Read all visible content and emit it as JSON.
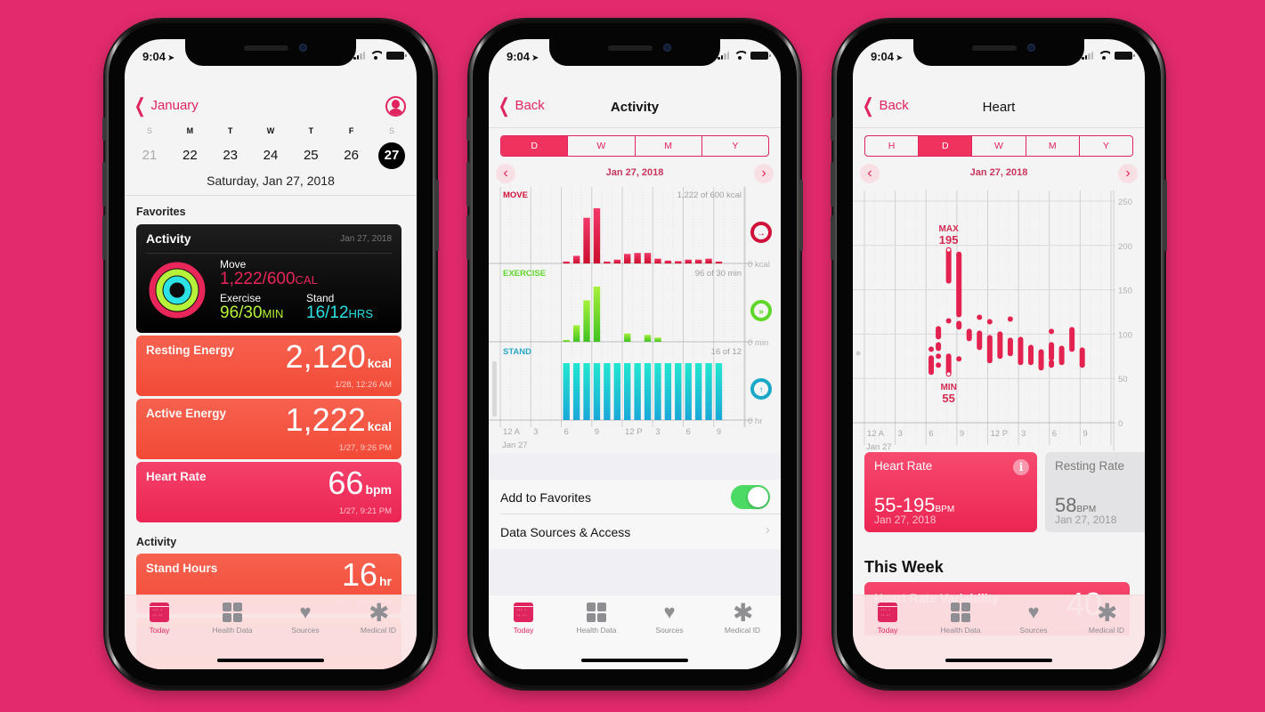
{
  "status_bar": {
    "time": "9:04"
  },
  "tab_bar": [
    {
      "label": "Today",
      "icon": "calendar-icon",
      "active": true
    },
    {
      "label": "Health Data",
      "icon": "grid-icon",
      "active": false
    },
    {
      "label": "Sources",
      "icon": "heart-download-icon",
      "active": false
    },
    {
      "label": "Medical ID",
      "icon": "asterisk-icon",
      "active": false
    }
  ],
  "today": {
    "back_label": "January",
    "week": [
      {
        "letter": "S",
        "num": "21"
      },
      {
        "letter": "M",
        "num": "22"
      },
      {
        "letter": "T",
        "num": "23"
      },
      {
        "letter": "W",
        "num": "24"
      },
      {
        "letter": "T",
        "num": "25"
      },
      {
        "letter": "F",
        "num": "26"
      },
      {
        "letter": "S",
        "num": "27"
      }
    ],
    "full_date": "Saturday, Jan 27, 2018",
    "favorites_label": "Favorites",
    "activity_card": {
      "title": "Activity",
      "date": "Jan 27, 2018",
      "move_label": "Move",
      "move_value": "1,222/600",
      "move_unit": "CAL",
      "exercise_label": "Exercise",
      "exercise_value": "96/30",
      "exercise_unit": "MIN",
      "stand_label": "Stand",
      "stand_value": "16/12",
      "stand_unit": "HRS",
      "rings": {
        "move": 2.04,
        "exercise": 3.2,
        "stand": 1.33
      }
    },
    "cards": [
      {
        "name": "Resting Energy",
        "value": "2,120",
        "unit": "kcal",
        "when": "1/28, 12:26 AM"
      },
      {
        "name": "Active Energy",
        "value": "1,222",
        "unit": "kcal",
        "when": "1/27, 9:26 PM"
      },
      {
        "name": "Heart Rate",
        "value": "66",
        "unit": "bpm",
        "when": "1/27, 9:21 PM"
      }
    ],
    "activity_label": "Activity",
    "stand_card": {
      "name": "Stand Hours",
      "value": "16",
      "unit": "hr",
      "when": "1/27, 10:00 PM"
    }
  },
  "activity": {
    "back_label": "Back",
    "title": "Activity",
    "segments": [
      "D",
      "W",
      "M",
      "Y"
    ],
    "selected_segment": "D",
    "date": "Jan 27, 2018",
    "add_to_favorites": "Add to Favorites",
    "add_to_favorites_on": true,
    "data_sources": "Data Sources & Access"
  },
  "heart": {
    "back_label": "Back",
    "title": "Heart",
    "segments": [
      "H",
      "D",
      "W",
      "M",
      "Y"
    ],
    "selected_segment": "D",
    "date": "Jan 27, 2018",
    "hr_card": {
      "name": "Heart Rate",
      "value": "55-195",
      "unit": "BPM",
      "date": "Jan 27, 2018"
    },
    "resting_card": {
      "name": "Resting Rate",
      "value": "58",
      "unit": "BPM",
      "date": "Jan 27, 2018"
    },
    "this_week": "This Week",
    "hrv_card": {
      "name": "Heart Rate Variability",
      "value": "40",
      "unit": "ms"
    }
  },
  "chart_data": [
    {
      "type": "bar",
      "title": "Activity - Jan 27, 2018",
      "x_ticks": [
        "12 A",
        "3",
        "6",
        "9",
        "12 P",
        "3",
        "6",
        "9"
      ],
      "x_sublabel": "Jan 27",
      "hours": [
        0,
        1,
        2,
        3,
        4,
        5,
        6,
        7,
        8,
        9,
        10,
        11,
        12,
        13,
        14,
        15,
        16,
        17,
        18,
        19,
        20,
        21,
        22,
        23
      ],
      "series": [
        {
          "name": "MOVE",
          "summary": "1,222 of 600 kcal",
          "baseline_label": "0 kcal",
          "color": "#e0143c",
          "values": [
            0,
            0,
            0,
            0,
            0,
            0,
            10,
            40,
            240,
            290,
            10,
            20,
            50,
            55,
            55,
            25,
            15,
            12,
            20,
            20,
            25,
            10,
            0,
            0
          ]
        },
        {
          "name": "EXERCISE",
          "summary": "96 of 30 min",
          "baseline_label": "0 min",
          "color": "#5fd62a",
          "values": [
            0,
            0,
            0,
            0,
            0,
            0,
            1,
            12,
            30,
            40,
            0,
            0,
            6,
            0,
            5,
            3,
            0,
            0,
            0,
            0,
            0,
            0,
            0,
            0
          ]
        },
        {
          "name": "STAND",
          "summary": "16 of 12",
          "baseline_label": "0 hr",
          "color": "#1ec8d8",
          "values": [
            0,
            0,
            0,
            0,
            0,
            0,
            1,
            1,
            1,
            1,
            1,
            1,
            1,
            1,
            1,
            1,
            1,
            1,
            1,
            1,
            1,
            1,
            0,
            0
          ]
        }
      ]
    },
    {
      "type": "range",
      "title": "Heart Rate - Jan 27, 2018",
      "ylim": [
        0,
        250
      ],
      "y_ticks": [
        250,
        200,
        150,
        100,
        50,
        0
      ],
      "x_ticks": [
        "12 A",
        "3",
        "6",
        "9",
        "12 P",
        "3",
        "6",
        "9"
      ],
      "x_sublabel": "Jan 27",
      "max_label": "MAX",
      "max_value": 195,
      "min_label": "MIN",
      "min_value": 55,
      "ranges": [
        [
          6.0,
          57,
          73
        ],
        [
          6.0,
          83,
          83
        ],
        [
          6.7,
          65,
          65
        ],
        [
          6.7,
          75,
          75
        ],
        [
          6.7,
          84,
          88
        ],
        [
          6.7,
          97,
          106
        ],
        [
          7.7,
          55,
          75
        ],
        [
          7.7,
          160,
          195
        ],
        [
          7.7,
          115,
          115
        ],
        [
          8.7,
          72,
          72
        ],
        [
          8.7,
          108,
          112
        ],
        [
          8.7,
          122,
          190
        ],
        [
          9.7,
          95,
          103
        ],
        [
          10.7,
          85,
          101
        ],
        [
          10.7,
          119,
          119
        ],
        [
          11.7,
          70,
          96
        ],
        [
          11.7,
          114,
          114
        ],
        [
          12.7,
          75,
          100
        ],
        [
          13.7,
          78,
          93
        ],
        [
          13.7,
          117,
          117
        ],
        [
          14.7,
          68,
          94
        ],
        [
          15.7,
          68,
          85
        ],
        [
          16.7,
          62,
          80
        ],
        [
          17.7,
          65,
          68
        ],
        [
          17.7,
          73,
          88
        ],
        [
          17.7,
          103,
          103
        ],
        [
          18.7,
          68,
          84
        ],
        [
          19.7,
          83,
          105
        ],
        [
          20.7,
          65,
          82
        ]
      ]
    }
  ]
}
